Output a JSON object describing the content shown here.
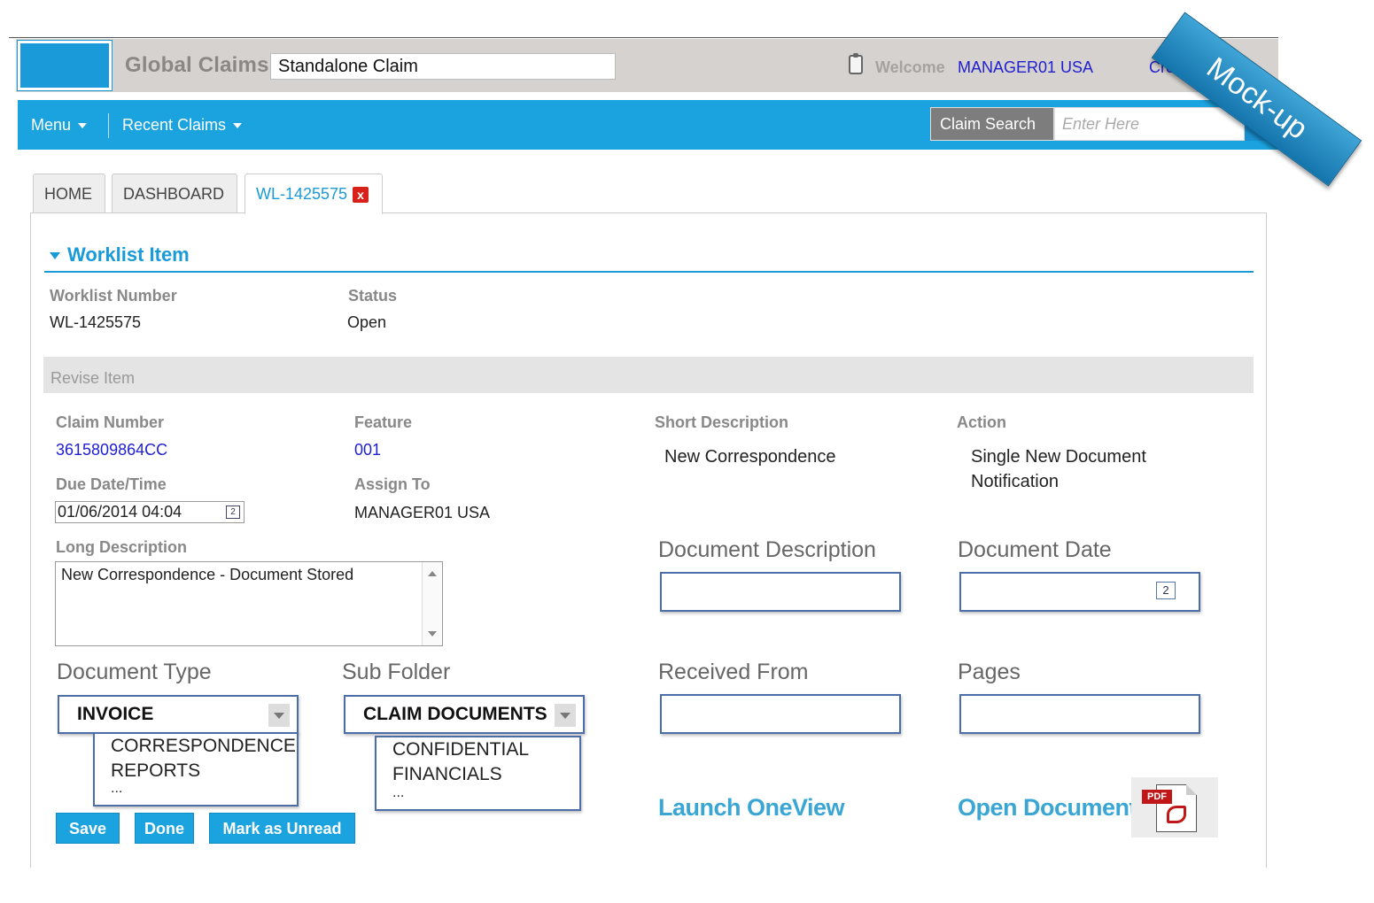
{
  "header": {
    "app_title": "Global Claims",
    "claim_type_value": "Standalone Claim",
    "welcome_label": "Welcome",
    "user_name": "MANAGER01 USA",
    "create_link": "Cre"
  },
  "ribbon": {
    "text": "Mock-up"
  },
  "nav": {
    "menu_label": "Menu",
    "recent_claims_label": "Recent Claims",
    "claim_search_label": "Claim Search",
    "search_placeholder": "Enter Here"
  },
  "tabs": [
    {
      "label": "HOME"
    },
    {
      "label": "DASHBOARD"
    },
    {
      "label": "WL-1425575",
      "close": "x"
    }
  ],
  "worklist": {
    "section_title": "Worklist Item",
    "number_label": "Worklist Number",
    "number_value": "WL-1425575",
    "status_label": "Status",
    "status_value": "Open"
  },
  "revise": {
    "title": "Revise Item",
    "claim_number_label": "Claim Number",
    "claim_number_value": "3615809864CC",
    "feature_label": "Feature",
    "feature_value": "001",
    "short_desc_label": "Short Description",
    "short_desc_value": "New Correspondence",
    "action_label": "Action",
    "action_value_line1": "Single New Document",
    "action_value_line2": "Notification",
    "due_label": "Due Date/Time",
    "due_value": "01/06/2014 04:04",
    "assign_label": "Assign To",
    "assign_value": "MANAGER01 USA",
    "long_desc_label": "Long Description",
    "long_desc_value": "New Correspondence - Document Stored"
  },
  "document": {
    "description_label": "Document Description",
    "date_label": "Document Date",
    "type_label": "Document Type",
    "type_selected": "INVOICE",
    "type_options": [
      "CORRESPONDENCE",
      "REPORTS",
      "..."
    ],
    "subfolder_label": "Sub Folder",
    "subfolder_selected": "CLAIM DOCUMENTS",
    "subfolder_options": [
      "CONFIDENTIAL",
      "FINANCIALS",
      "..."
    ],
    "received_label": "Received From",
    "pages_label": "Pages",
    "launch_link": "Launch OneView",
    "open_link": "Open Document",
    "pdf_tag": "PDF"
  },
  "buttons": {
    "save": "Save",
    "done": "Done",
    "mark_unread": "Mark as Unread"
  },
  "colors": {
    "brand_blue": "#1aa3df",
    "header_gray": "#d6d2cf",
    "link_blue": "#2020d0"
  },
  "icons": [
    "clipboard-icon",
    "search-icon",
    "close-icon",
    "calendar-icon",
    "chevron-down-icon",
    "pdf-icon"
  ]
}
